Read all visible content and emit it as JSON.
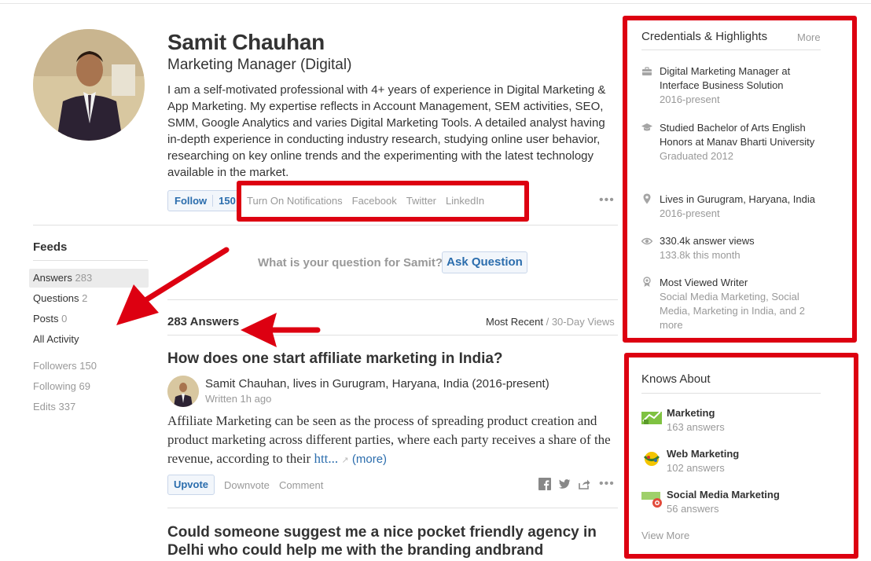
{
  "profile": {
    "name": "Samit Chauhan",
    "role": "Marketing Manager (Digital)",
    "bio": "I am a self-motivated professional with 4+ years of experience in Digital Marketing & App Marketing. My expertise reflects in Account Management, SEM activities, SEO, SMM, Google Analytics and varies Digital Marketing Tools. A detailed analyst having in-depth experience in conducting industry research, studying online user behavior, researching on key online trends and the experimenting with the latest technology available in the market.",
    "follow_label": "Follow",
    "follow_count": "150",
    "links": [
      "Turn On Notifications",
      "Facebook",
      "Twitter",
      "LinkedIn"
    ],
    "more_label": "•••"
  },
  "feeds": {
    "title": "Feeds",
    "items": [
      {
        "label": "Answers",
        "count": "283"
      },
      {
        "label": "Questions",
        "count": "2"
      },
      {
        "label": "Posts",
        "count": "0"
      },
      {
        "label": "All Activity",
        "count": ""
      }
    ],
    "stats": [
      {
        "label": "Followers",
        "count": "150"
      },
      {
        "label": "Following",
        "count": "69"
      },
      {
        "label": "Edits",
        "count": "337"
      }
    ]
  },
  "ask": {
    "prompt": "What is your question for Samit?",
    "button": "Ask Question"
  },
  "answers": {
    "count_label": "283 Answers",
    "sort_active": "Most Recent",
    "sort_sep": " / ",
    "sort_alt": "30-Day Views"
  },
  "answer1": {
    "question": "How does one start affiliate marketing in India?",
    "author": "Samit Chauhan, lives in Gurugram, Haryana, India (2016-present)",
    "written": "Written 1h ago",
    "body": "Affiliate Marketing can be seen as the process of spreading product creation and product marketing across different parties, where each party receives a share of the revenue, according to their ",
    "link_text": "htt...",
    "more": "(more)",
    "upvote": "Upvote",
    "downvote": "Downvote",
    "comment": "Comment"
  },
  "answer2": {
    "question": "Could someone suggest me a nice pocket friendly agency in Delhi who could help me with the branding andbrand communication?"
  },
  "credentials": {
    "title": "Credentials & Highlights",
    "more": "More",
    "items": [
      {
        "icon": "briefcase-icon",
        "text": "Digital Marketing Manager at Interface Business Solution",
        "sub": "2016-present"
      },
      {
        "icon": "graduation-cap-icon",
        "text": "Studied Bachelor of Arts English Honors at Manav Bharti University",
        "sub": "Graduated 2012"
      },
      {
        "icon": "location-pin-icon",
        "text": "Lives in Gurugram, Haryana, India",
        "sub": "2016-present"
      },
      {
        "icon": "eye-icon",
        "text": "330.4k answer views",
        "sub": "133.8k this month"
      },
      {
        "icon": "award-icon",
        "text": "Most Viewed Writer",
        "sub": "Social Media Marketing, Social Media, Marketing in India, and 2 more"
      }
    ]
  },
  "knows_about": {
    "title": "Knows About",
    "topics": [
      {
        "name": "Marketing",
        "count": "163 answers"
      },
      {
        "name": "Web Marketing",
        "count": "102 answers"
      },
      {
        "name": "Social Media Marketing",
        "count": "56 answers"
      }
    ],
    "view_more": "View More"
  },
  "colors": {
    "accent_blue": "#2b6dad",
    "highlight_red": "#dd0011",
    "muted_gray": "#999999"
  }
}
